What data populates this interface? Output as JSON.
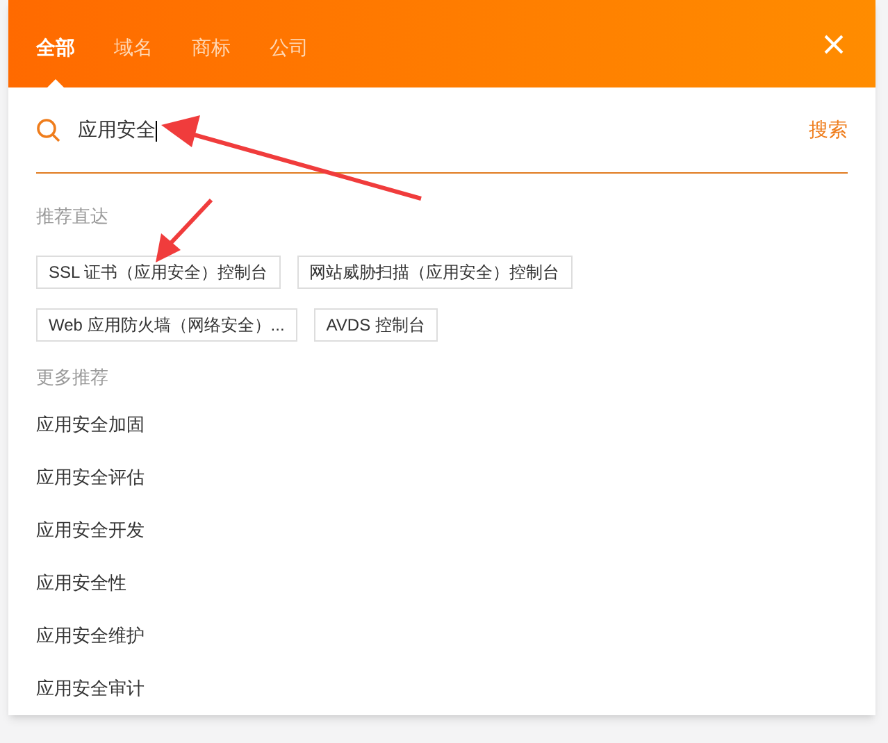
{
  "tabs": [
    {
      "label": "全部",
      "selected": true
    },
    {
      "label": "域名",
      "selected": false
    },
    {
      "label": "商标",
      "selected": false
    },
    {
      "label": "公司",
      "selected": false
    }
  ],
  "search": {
    "value": "应用安全",
    "button": "搜索"
  },
  "direct": {
    "heading": "推荐直达",
    "items": [
      "SSL 证书（应用安全）控制台",
      "网站威胁扫描（应用安全）控制台",
      "Web 应用防火墙（网络安全）...",
      "AVDS 控制台"
    ]
  },
  "more": {
    "heading": "更多推荐",
    "items": [
      "应用安全加固",
      "应用安全评估",
      "应用安全开发",
      "应用安全性",
      "应用安全维护",
      "应用安全审计"
    ]
  }
}
